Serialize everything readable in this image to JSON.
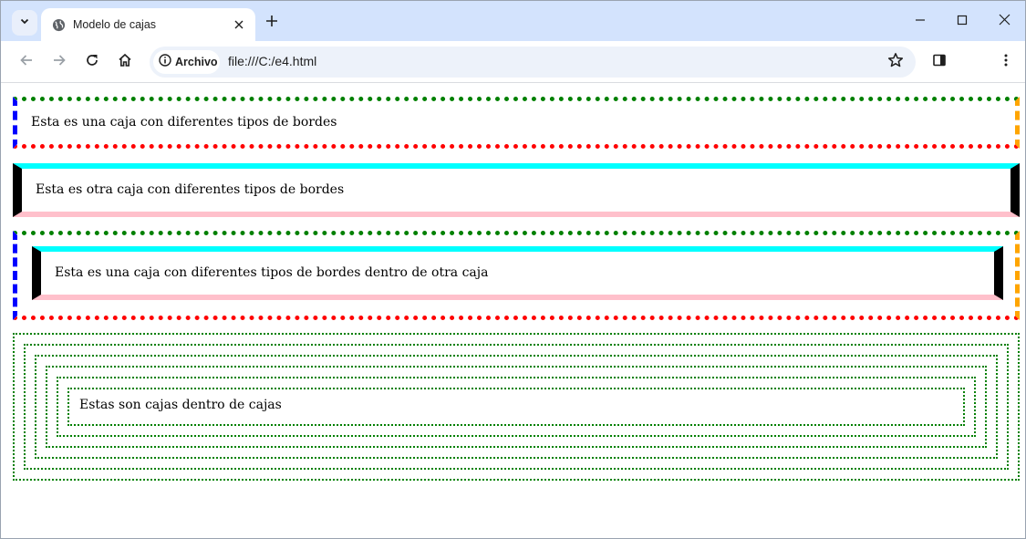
{
  "browser": {
    "tab_title": "Modelo de cajas",
    "security_chip_label": "Archivo",
    "url": "file:///C:/e4.html",
    "accent_color": "#d3e3fd"
  },
  "page": {
    "box1_text": "Esta es una caja con diferentes tipos de bordes",
    "box2_text": "Esta es otra caja con diferentes tipos de bordes",
    "box3_inner_text": "Esta es una caja con diferentes tipos de bordes dentro de otra caja",
    "nested_text": "Estas son cajas dentro de cajas",
    "border_colors": {
      "top_dotted": "#008000",
      "right_dashed": "#ffa500",
      "bottom_dotted": "#ff0000",
      "left_dashed": "#0000ff",
      "solid_top": "#00ffff",
      "solid_sides": "#000000",
      "solid_bottom": "#ffc0cb",
      "nested_dotted": "#008000"
    }
  },
  "icons": {
    "tab_search": "chevron-down-icon",
    "favicon": "globe-icon",
    "close_tab": "close-icon",
    "new_tab": "plus-icon",
    "minimize": "minimize-icon",
    "maximize": "maximize-icon",
    "close_window": "close-icon",
    "back": "back-arrow-icon",
    "forward": "forward-arrow-icon",
    "reload": "reload-icon",
    "home": "home-icon",
    "info": "info-icon",
    "bookmark": "star-icon",
    "side_panel": "side-panel-icon",
    "menu": "kebab-menu-icon"
  }
}
